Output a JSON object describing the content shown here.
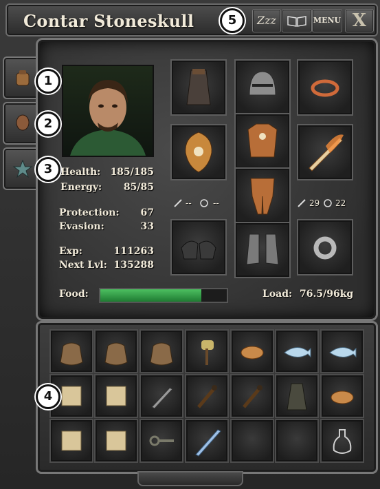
{
  "window": {
    "title": "Contar Stoneskull",
    "buttons": {
      "sleep": "Zzz",
      "menu": "MENU",
      "close": "X"
    }
  },
  "badges": [
    "1",
    "2",
    "3",
    "4",
    "5"
  ],
  "stats": {
    "health_label": "Health:",
    "health_value": "185/185",
    "energy_label": "Energy:",
    "energy_value": "85/85",
    "protection_label": "Protection:",
    "protection_value": "67",
    "evasion_label": "Evasion:",
    "evasion_value": "33",
    "exp_label": "Exp:",
    "exp_value": "111263",
    "next_label": "Next Lvl:",
    "next_value": "135288",
    "food_label": "Food:",
    "food_fraction": 0.8,
    "load_label": "Load:",
    "load_value": "76.5/96kg"
  },
  "equipment": {
    "offhand_attack": "--",
    "offhand_accuracy": "--",
    "weapon_attack": "29",
    "weapon_accuracy": "22",
    "slots": [
      "cloak",
      "helmet",
      "amulet",
      "shield",
      "chest-armor",
      "flaming-sword",
      "leg-armor",
      "gauntlets",
      "boots",
      "ring"
    ]
  },
  "inventory": {
    "rows": [
      [
        "sack",
        "sack",
        "sack",
        "hammer",
        "bread",
        "fish",
        "fish"
      ],
      [
        "scroll",
        "scroll",
        "knife",
        "torch",
        "torch",
        "cloak",
        "bread"
      ],
      [
        "scroll",
        "scroll",
        "key",
        "sword",
        "",
        "",
        "potion"
      ]
    ]
  },
  "colors": {
    "food": "#2f9a44",
    "text": "#f1ead9",
    "frame": "#777777"
  }
}
